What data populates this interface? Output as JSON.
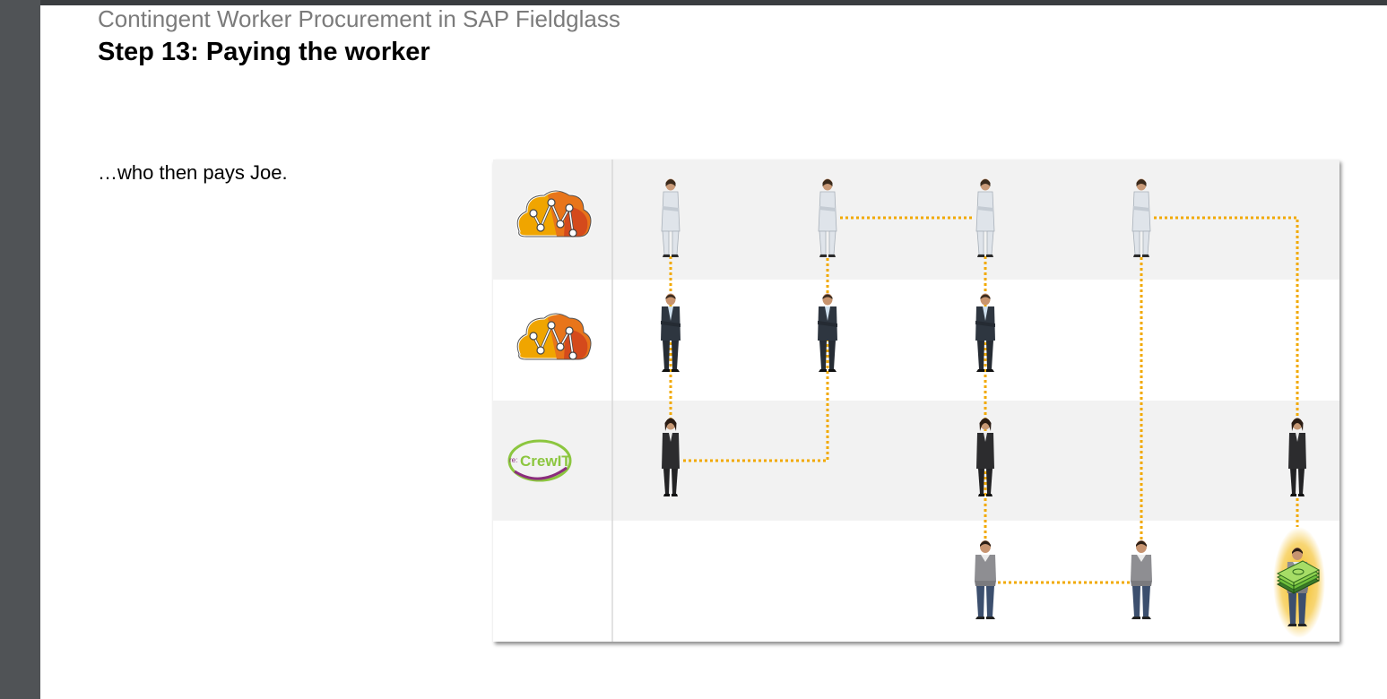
{
  "header": {
    "subtitle": "Contingent Worker Procurement in SAP Fieldglass",
    "title": "Step 13: Paying the worker"
  },
  "body": {
    "text": "…who then pays Joe."
  },
  "diagram": {
    "lanes": [
      {
        "logo": "sap-network-cloud-logo-icon"
      },
      {
        "logo": "sap-network-cloud-logo-icon"
      },
      {
        "logo": "recrewit-logo"
      },
      {
        "logo": "none"
      }
    ],
    "logo_text": {
      "prefix": "re:",
      "name": "CrewIT"
    },
    "colors": {
      "lane_alt": "#f2f2f2",
      "connector": "#f2a900",
      "logo_orange": "#f0a500",
      "logo_dark_orange": "#d94f1a",
      "recrewit_green": "#8cc63f",
      "recrewit_purple": "#8b2d7d",
      "highlight_glow": "#f2b400"
    },
    "icons": [
      "woman-in-white-suit-icon",
      "man-in-dark-suit-icon",
      "woman-in-dark-suit-icon",
      "worker-joe-icon",
      "money-stack-icon"
    ]
  }
}
